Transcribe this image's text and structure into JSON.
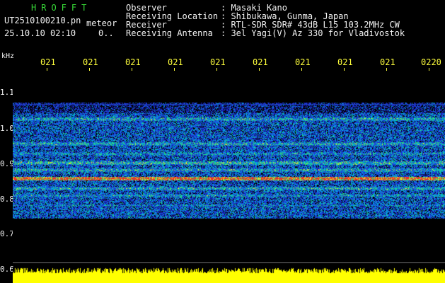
{
  "header": {
    "station_code": "HROFFT",
    "filename": "UT2510100210.pn",
    "mode": "meteor",
    "date_time": "25.10.10 02:10",
    "count": "0..",
    "fields": [
      {
        "label": "Observer",
        "value": ": Masaki Kano"
      },
      {
        "label": "Receiving Location",
        "value": ": Shibukawa, Gunma, Japan"
      },
      {
        "label": "Receiver",
        "value": ": RTL-SDR SDR# 43dB L15 103.2MHz CW"
      },
      {
        "label": "Receiving Antenna",
        "value": ": 3el Yagi(V) Az 330 for Vladivostok"
      }
    ]
  },
  "axis": {
    "y_unit": "kHz",
    "y_ticks": [
      "1.1",
      "1.0",
      "0.9",
      "0.8",
      "0.7",
      "0.6"
    ],
    "x_ticks": [
      "021",
      "021",
      "021",
      "021",
      "021",
      "021",
      "021",
      "021",
      "021",
      "0220"
    ]
  },
  "colors": {
    "background": "#000000",
    "header_green": "#37d837",
    "label_white": "#f2f2f2",
    "tick_yellow": "#ffff3c",
    "spectrum_noise": "#1414a0",
    "band_yellow": "#ffff00"
  }
}
